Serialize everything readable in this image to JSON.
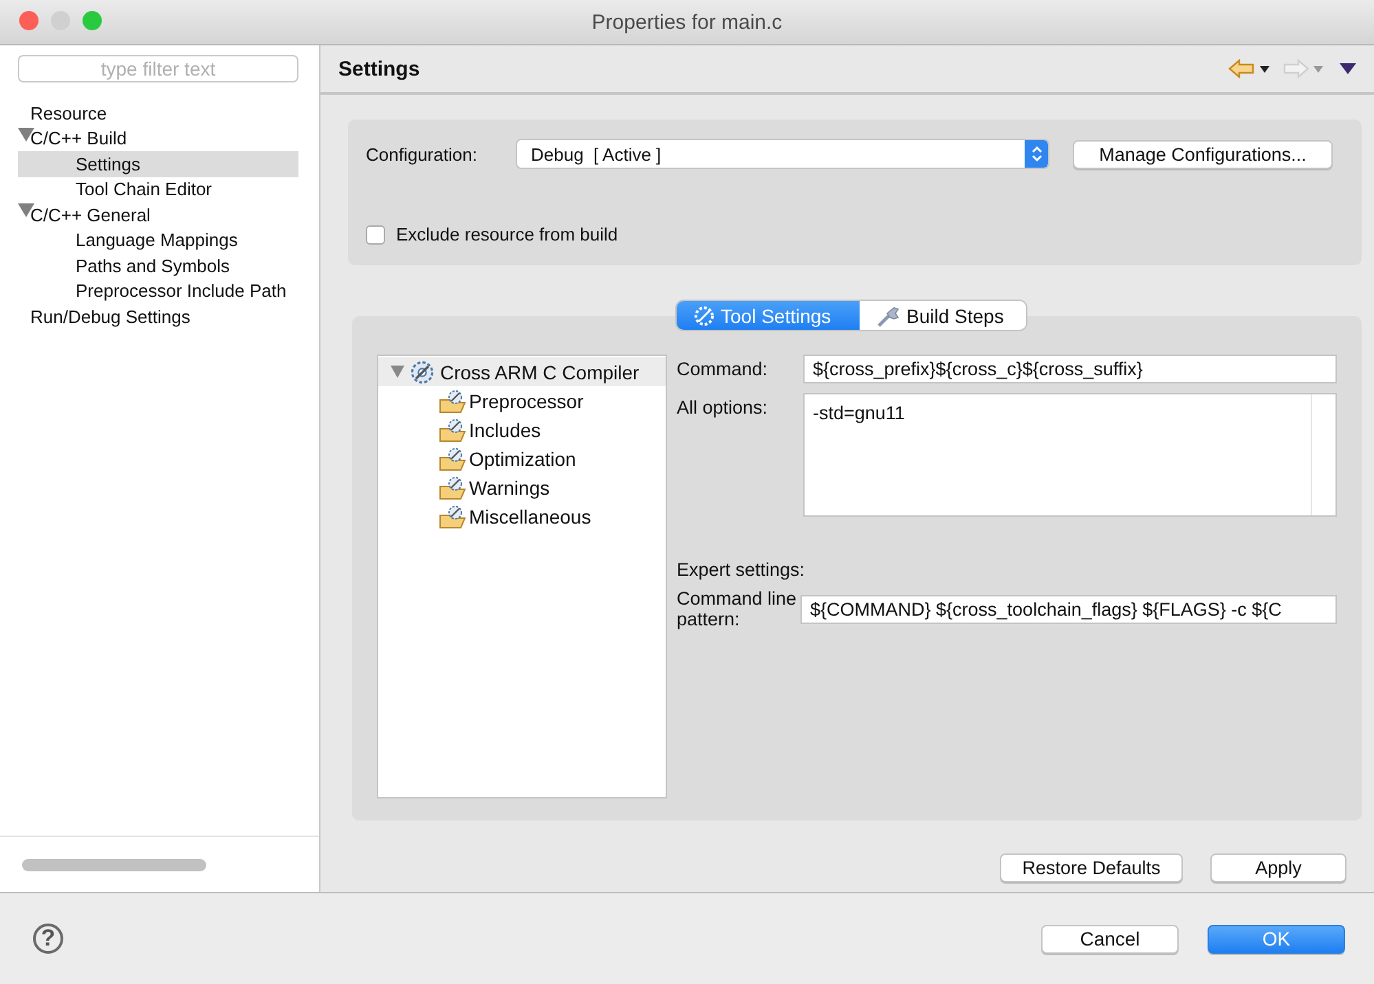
{
  "window": {
    "title": "Properties for main.c"
  },
  "sidebar": {
    "filter": {
      "placeholder": "type filter text"
    },
    "items": [
      {
        "label": "Resource",
        "selected": false
      },
      {
        "label": "C/C++ Build",
        "expanded": true,
        "selected": false,
        "children": [
          {
            "label": "Settings",
            "selected": true
          },
          {
            "label": "Tool Chain Editor",
            "selected": false
          }
        ]
      },
      {
        "label": "C/C++ General",
        "expanded": true,
        "selected": false,
        "children": [
          {
            "label": "Language Mappings",
            "selected": false
          },
          {
            "label": "Paths and Symbols",
            "selected": false
          },
          {
            "label": "Preprocessor Include Path",
            "selected": false
          }
        ]
      },
      {
        "label": "Run/Debug Settings",
        "selected": false
      }
    ]
  },
  "page": {
    "title": "Settings"
  },
  "configuration": {
    "label": "Configuration:",
    "value": "Debug  [ Active ]",
    "manage_button": "Manage Configurations..."
  },
  "exclude": {
    "label": "Exclude resource from build",
    "checked": false
  },
  "tabs": [
    {
      "label": "Tool Settings",
      "selected": true
    },
    {
      "label": "Build Steps",
      "selected": false
    }
  ],
  "tool_tree": {
    "items": [
      {
        "label": "Cross ARM C Compiler",
        "expanded": true,
        "selected": true,
        "children": [
          {
            "label": "Preprocessor",
            "selected": false
          },
          {
            "label": "Includes",
            "selected": false
          },
          {
            "label": "Optimization",
            "selected": false
          },
          {
            "label": "Warnings",
            "selected": false
          },
          {
            "label": "Miscellaneous",
            "selected": false
          }
        ]
      }
    ]
  },
  "command": {
    "label": "Command:",
    "value": "${cross_prefix}${cross_c}${cross_suffix}"
  },
  "all_options": {
    "label": "All options:",
    "value": "-std=gnu11"
  },
  "expert": {
    "heading": "Expert settings:",
    "label": "Command line pattern:",
    "value": "${COMMAND} ${cross_toolchain_flags} ${FLAGS} -c ${C"
  },
  "page_buttons": [
    {
      "label": "Restore Defaults"
    },
    {
      "label": "Apply"
    }
  ],
  "footer": {
    "help": "?",
    "buttons": [
      {
        "label": "Cancel",
        "default": false
      },
      {
        "label": "OK",
        "default": true
      }
    ]
  }
}
